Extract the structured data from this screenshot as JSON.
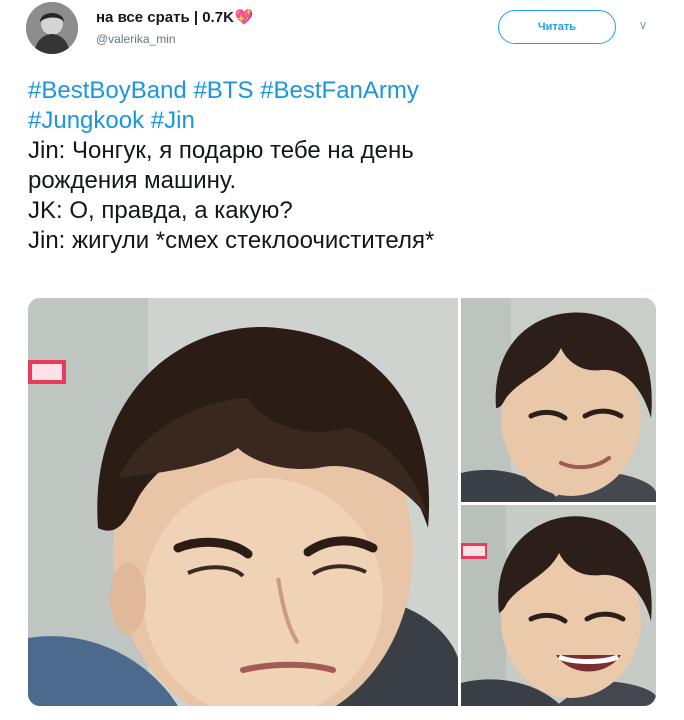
{
  "tweet": {
    "author_name": "на все срать | 0.7K",
    "author_handle": "@valerika_min",
    "follow_label": "Читать",
    "hashtags_line1": [
      "#BestBoyBand",
      "#BTS",
      "#BestFanArmy"
    ],
    "hashtags_line2": [
      "#Jungkook",
      "#Jin"
    ],
    "lines": [
      "Jin: Чонгук, я подарю тебе на день",
      "рождения машину.",
      "JK: О, правда, а какую?",
      "Jin: жигули *смех стеклоочистителя*"
    ]
  },
  "colors": {
    "accent": "#1da1f2",
    "hashtag": "#1b95e0",
    "text": "#14171a",
    "muted": "#657786",
    "heart": "#e8457c"
  },
  "icons": {
    "heart": "heart-icon",
    "caret": "chevron-down-icon"
  }
}
